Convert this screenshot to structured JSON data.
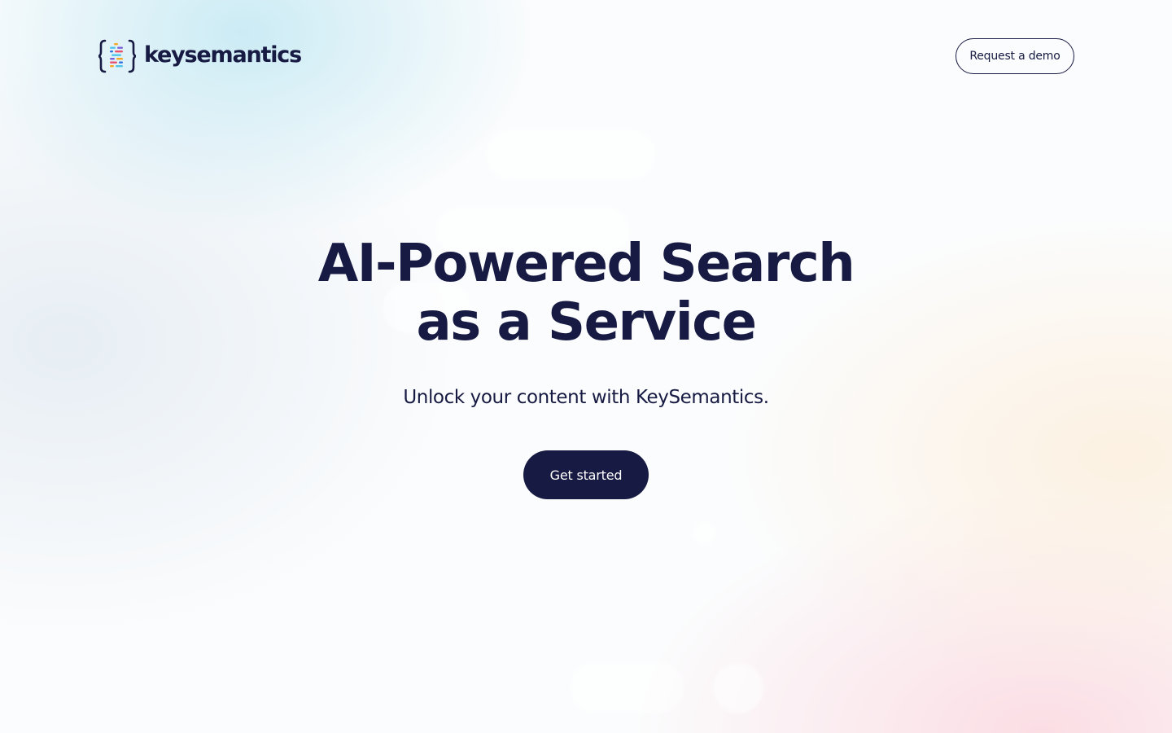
{
  "header": {
    "logo_text": "keysemantics",
    "logo_icon": "brackets-logo-icon",
    "demo_button_label": "Request a demo"
  },
  "hero": {
    "headline_line1": "AI-Powered Search",
    "headline_line2": "as a Service",
    "subtitle": "Unlock your content with KeySemantics.",
    "cta_label": "Get started"
  },
  "colors": {
    "brand_navy": "#171a42",
    "logo_bars": [
      "#4fc3e8",
      "#f5a623",
      "#e8506e",
      "#7b61d9",
      "#2f6fe0"
    ]
  }
}
